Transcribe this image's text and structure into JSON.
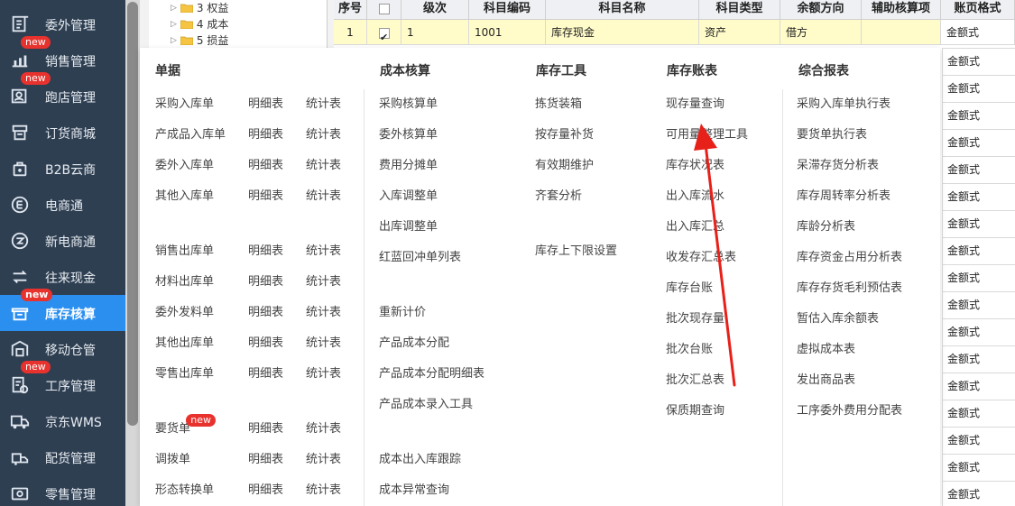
{
  "sidebar": {
    "items": [
      {
        "label": "委外管理",
        "icon": "outsource-icon",
        "new": false,
        "active": false
      },
      {
        "label": "销售管理",
        "icon": "sales-chart-icon",
        "new": true,
        "active": false
      },
      {
        "label": "跑店管理",
        "icon": "store-visit-icon",
        "new": true,
        "active": false
      },
      {
        "label": "订货商城",
        "icon": "mall-icon",
        "new": false,
        "active": false
      },
      {
        "label": "B2B云商",
        "icon": "b2b-bag-icon",
        "new": false,
        "active": false
      },
      {
        "label": "电商通",
        "icon": "ecommerce-icon",
        "new": false,
        "active": false
      },
      {
        "label": "新电商通",
        "icon": "new-ecommerce-icon",
        "new": false,
        "active": false
      },
      {
        "label": "往来现金",
        "icon": "cash-transfer-icon",
        "new": false,
        "active": false
      },
      {
        "label": "库存核算",
        "icon": "inventory-icon",
        "new": true,
        "active": true
      },
      {
        "label": "移动仓管",
        "icon": "mobile-warehouse-icon",
        "new": false,
        "active": false
      },
      {
        "label": "工序管理",
        "icon": "process-icon",
        "new": true,
        "active": false
      },
      {
        "label": "京东WMS",
        "icon": "truck-icon",
        "new": false,
        "active": false
      },
      {
        "label": "配货管理",
        "icon": "distribution-icon",
        "new": false,
        "active": false
      },
      {
        "label": "零售管理",
        "icon": "retail-icon",
        "new": false,
        "active": false
      }
    ],
    "new_badge": "new"
  },
  "tree": {
    "nodes": [
      "3 权益",
      "4 成本",
      "5 损益"
    ]
  },
  "grid": {
    "headers": [
      "序号",
      "",
      "级次",
      "科目编码",
      "科目名称",
      "科目类型",
      "余额方向",
      "辅助核算项",
      "账页格式"
    ],
    "row": {
      "index": "1",
      "checked": true,
      "level": "1",
      "code": "1001",
      "name": "库存现金",
      "type": "资产",
      "direction": "借方",
      "aux": "",
      "format": "金额式"
    },
    "format_column": [
      "金额式",
      "金额式",
      "金额式",
      "金额式",
      "金额式",
      "金额式",
      "金额式",
      "金额式",
      "金额式",
      "金额式",
      "金额式",
      "金额式",
      "金额式",
      "金额式",
      "金额式",
      "金额式",
      "金额式"
    ]
  },
  "menu": {
    "columns": [
      {
        "title": "单据"
      },
      {
        "title": "成本核算"
      },
      {
        "title": "库存工具"
      },
      {
        "title": "库存账表"
      },
      {
        "title": "综合报表"
      }
    ],
    "documents": [
      {
        "label": "采购入库单",
        "detail": "明细表",
        "stat": "统计表",
        "new": false
      },
      {
        "label": "产成品入库单",
        "detail": "明细表",
        "stat": "统计表",
        "new": false
      },
      {
        "label": "委外入库单",
        "detail": "明细表",
        "stat": "统计表",
        "new": false
      },
      {
        "label": "其他入库单",
        "detail": "明细表",
        "stat": "统计表",
        "new": false
      },
      {
        "label": "销售出库单",
        "detail": "明细表",
        "stat": "统计表",
        "new": false
      },
      {
        "label": "材料出库单",
        "detail": "明细表",
        "stat": "统计表",
        "new": false
      },
      {
        "label": "委外发料单",
        "detail": "明细表",
        "stat": "统计表",
        "new": false
      },
      {
        "label": "其他出库单",
        "detail": "明细表",
        "stat": "统计表",
        "new": false
      },
      {
        "label": "零售出库单",
        "detail": "明细表",
        "stat": "统计表",
        "new": false
      },
      {
        "label": "要货单",
        "detail": "明细表",
        "stat": "统计表",
        "new": true
      },
      {
        "label": "调拨单",
        "detail": "明细表",
        "stat": "统计表",
        "new": false
      },
      {
        "label": "形态转换单",
        "detail": "明细表",
        "stat": "统计表",
        "new": false
      }
    ],
    "cost": [
      "采购核算单",
      "委外核算单",
      "费用分摊单",
      "入库调整单",
      "出库调整单",
      "红蓝回冲单列表",
      "重新计价",
      "产品成本分配",
      "产品成本分配明细表",
      "产品成本录入工具",
      "成本出入库跟踪",
      "成本异常查询"
    ],
    "tools": [
      "拣货装箱",
      "按存量补货",
      "有效期维护",
      "齐套分析",
      "库存上下限设置"
    ],
    "ledgers": [
      "现存量查询",
      "可用量整理工具",
      "库存状况表",
      "出入库流水",
      "出入库汇总",
      "收发存汇总表",
      "库存台账",
      "批次现存量",
      "批次台账",
      "批次汇总表",
      "保质期查询"
    ],
    "reports": [
      "采购入库单执行表",
      "要货单执行表",
      "呆滞存货分析表",
      "库存周转率分析表",
      "库龄分析表",
      "库存资金占用分析表",
      "库存存货毛利预估表",
      "暂估入库余额表",
      "虚拟成本表",
      "发出商品表",
      "工序委外费用分配表"
    ]
  },
  "colors": {
    "sidebar_bg": "#2f3f52",
    "active_bg": "#2b8ff0",
    "badge": "#e8322d",
    "arrow": "#e8201a",
    "highlight_row": "#fffcc9"
  }
}
